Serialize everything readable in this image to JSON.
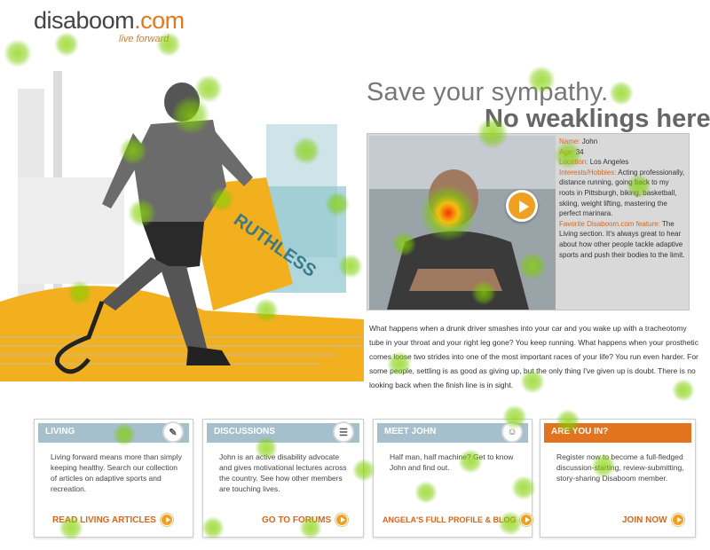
{
  "logo": {
    "name": "disaboom",
    "tld": ".com",
    "tagline": "live forward"
  },
  "hero": {
    "graphic_text": "RUTHLESS"
  },
  "headline": {
    "line1": "Save your sympathy.",
    "line2": "No weaklings here."
  },
  "profile": {
    "name_label": "Name:",
    "name": "John",
    "age_label": "Age:",
    "age": "34",
    "location_label": "Location:",
    "location": "Los Angeles",
    "interests_label": "Interests/Hobbies:",
    "interests": "Acting professionally, distance running, going back to my roots in Pittsburgh, biking, basketball, skiing, weight lifting, mastering the perfect marinara.",
    "feature_label": "Favorite Disaboom.com feature:",
    "feature": "The Living section. It's always great to hear about how other people tackle adaptive sports and push their bodies to the limit."
  },
  "story": "What happens when a drunk driver smashes into your car and you wake up with a tracheotomy tube in your throat and your right leg gone? You keep running. What happens when your prosthetic comes loose two strides into one of the most important races of your life? You run even harder. For some people, settling is as good as giving up, but the only thing I've given up is doubt. There is no looking back when the finish line is in sight.",
  "cards": [
    {
      "title": "LIVING",
      "icon": "pencil-icon",
      "body": "Living forward means more than simply keeping healthy. Search our collection of articles on adaptive sports and recreation.",
      "link": "READ LIVING ARTICLES"
    },
    {
      "title": "DISCUSSIONS",
      "icon": "document-icon",
      "body": "John is an active disability advocate and gives motivational lectures across the country. See how other members are touching lives.",
      "link": "GO TO FORUMS"
    },
    {
      "title": "MEET JOHN",
      "icon": "people-icon",
      "body": "Half man, half machine? Get to know John and find out.",
      "link": "ANGELA'S FULL PROFILE & BLOG"
    },
    {
      "title": "ARE YOU IN?",
      "icon": "",
      "body": "Register now to become a full-fledged discussion-starting, review-submitting, story-sharing Disaboom member.",
      "link": "JOIN NOW"
    }
  ],
  "colors": {
    "accent": "#e2731f",
    "card_header": "#a6bfcc",
    "heat_green": "#7acc00",
    "heat_red": "#ff2a00"
  }
}
